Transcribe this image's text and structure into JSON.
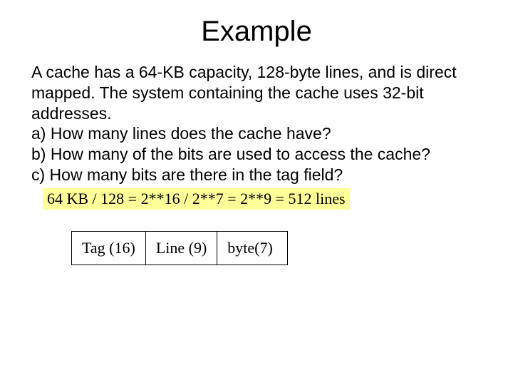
{
  "title": "Example",
  "problem": {
    "intro": "A cache has a 64-KB capacity, 128-byte lines, and is direct mapped. The system containing the cache uses 32-bit addresses.",
    "qa": " a) How many lines does the cache have?",
    "qb": " b) How many of the bits are used to access the cache?",
    "qc": " c) How many bits are there in the tag field?"
  },
  "calc": "64 KB / 128 = 2**16 / 2**7 = 2**9 = 512 lines",
  "fields": {
    "tag": "Tag (16)",
    "line": "Line (9)",
    "byte": "byte(7)"
  }
}
